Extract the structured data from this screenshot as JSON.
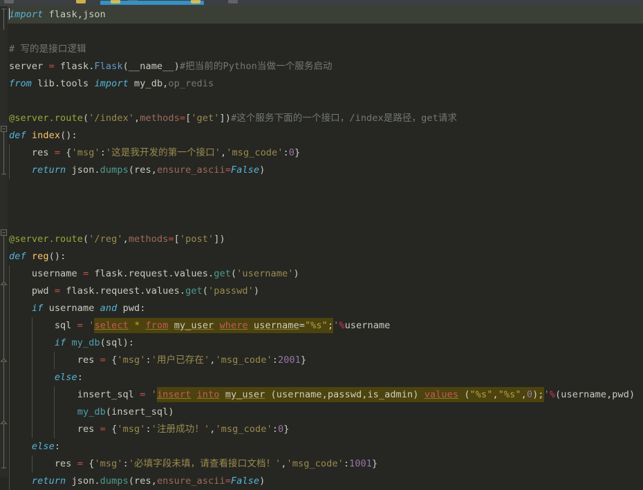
{
  "app": {
    "kind": "code-editor",
    "language": "Python",
    "theme": "darcula",
    "background": "#262722",
    "gutter_background": "#2B2C27",
    "current_line_background": "#3C3F36",
    "toolbar_background": "#3C3F41",
    "accent": "#3592C4"
  },
  "toolbar": {
    "progress_bar_color": "#3592C4",
    "icons": [
      {
        "name": "bulb-icon",
        "color": "#E8C44A"
      },
      {
        "name": "bulb-icon-2",
        "color": "#E8C44A"
      },
      {
        "name": "bulb-icon-3",
        "color": "#E8C44A"
      }
    ]
  },
  "colors": {
    "keyword": "#55B5DB",
    "string": "#9A8B4F",
    "number": "#9876AA",
    "comment": "#737874",
    "decorator": "#9AA83A",
    "function_def": "#FFC66D",
    "class_ref": "#6699CC",
    "operator": "#C7504B",
    "kwarg": "#9E6B5B",
    "sql_highlight_background": "#4C430E",
    "sql_keyword": "#C45B56"
  },
  "editor": {
    "caret_line": 1,
    "caret_column": 1,
    "lines": [
      {
        "n": 1,
        "current": true,
        "indent": 0,
        "caret": true,
        "tokens": [
          {
            "t": "import",
            "c": "kw"
          },
          {
            "t": " flask,json",
            "c": "txt"
          }
        ]
      },
      {
        "n": 2,
        "current": false,
        "indent": 0,
        "tokens": []
      },
      {
        "n": 3,
        "current": false,
        "indent": 0,
        "tokens": [
          {
            "t": "# 写的是接口逻辑",
            "c": "cmt"
          }
        ]
      },
      {
        "n": 4,
        "current": false,
        "indent": 0,
        "tokens": [
          {
            "t": "server ",
            "c": "txt"
          },
          {
            "t": "=",
            "c": "op"
          },
          {
            "t": " flask.",
            "c": "txt"
          },
          {
            "t": "Flask",
            "c": "cls"
          },
          {
            "t": "(",
            "c": "punc"
          },
          {
            "t": "__name__",
            "c": "txt"
          },
          {
            "t": ")",
            "c": "punc"
          },
          {
            "t": "#把当前的Python当做一个服务启动",
            "c": "cmt"
          }
        ]
      },
      {
        "n": 5,
        "current": false,
        "indent": 0,
        "tokens": [
          {
            "t": "from",
            "c": "kw"
          },
          {
            "t": " lib.tools ",
            "c": "txt"
          },
          {
            "t": "import",
            "c": "kw"
          },
          {
            "t": " my_db,",
            "c": "txt"
          },
          {
            "t": "op_redis",
            "c": "cmt"
          }
        ]
      },
      {
        "n": 6,
        "current": false,
        "indent": 0,
        "tokens": []
      },
      {
        "n": 7,
        "current": false,
        "indent": 0,
        "tokens": [
          {
            "t": "@server.route",
            "c": "dec"
          },
          {
            "t": "(",
            "c": "punc"
          },
          {
            "t": "'/index'",
            "c": "str"
          },
          {
            "t": ",",
            "c": "punc"
          },
          {
            "t": "methods",
            "c": "kwarg"
          },
          {
            "t": "=",
            "c": "op"
          },
          {
            "t": "[",
            "c": "punc"
          },
          {
            "t": "'get'",
            "c": "str"
          },
          {
            "t": "])",
            "c": "punc"
          },
          {
            "t": "#这个服务下面的一个接口，/index是路径，get请求",
            "c": "cmt"
          }
        ]
      },
      {
        "n": 8,
        "current": false,
        "indent": 0,
        "tokens": [
          {
            "t": "def",
            "c": "kw"
          },
          {
            "t": " ",
            "c": "txt"
          },
          {
            "t": "index",
            "c": "def"
          },
          {
            "t": "():",
            "c": "punc"
          }
        ]
      },
      {
        "n": 9,
        "current": false,
        "indent": 1,
        "tokens": [
          {
            "t": "res ",
            "c": "txt"
          },
          {
            "t": "=",
            "c": "op"
          },
          {
            "t": " {",
            "c": "punc"
          },
          {
            "t": "'msg'",
            "c": "str"
          },
          {
            "t": ":",
            "c": "punc"
          },
          {
            "t": "'这是我开发的第一个接口'",
            "c": "str"
          },
          {
            "t": ",",
            "c": "punc"
          },
          {
            "t": "'msg_code'",
            "c": "str"
          },
          {
            "t": ":",
            "c": "punc"
          },
          {
            "t": "0",
            "c": "num"
          },
          {
            "t": "}",
            "c": "punc"
          }
        ]
      },
      {
        "n": 10,
        "current": false,
        "indent": 1,
        "tokens": [
          {
            "t": "return",
            "c": "kw"
          },
          {
            "t": " json.",
            "c": "txt"
          },
          {
            "t": "dumps",
            "c": "fn"
          },
          {
            "t": "(res,",
            "c": "punc"
          },
          {
            "t": "ensure_ascii",
            "c": "kwarg"
          },
          {
            "t": "=",
            "c": "op"
          },
          {
            "t": "False",
            "c": "kw"
          },
          {
            "t": ")",
            "c": "punc"
          }
        ]
      },
      {
        "n": 11,
        "current": false,
        "indent": 0,
        "tokens": []
      },
      {
        "n": 12,
        "current": false,
        "indent": 0,
        "tokens": []
      },
      {
        "n": 13,
        "current": false,
        "indent": 0,
        "tokens": []
      },
      {
        "n": 14,
        "current": false,
        "indent": 0,
        "tokens": [
          {
            "t": "@server.route",
            "c": "dec"
          },
          {
            "t": "(",
            "c": "punc"
          },
          {
            "t": "'/reg'",
            "c": "str"
          },
          {
            "t": ",",
            "c": "punc"
          },
          {
            "t": "methods",
            "c": "kwarg"
          },
          {
            "t": "=",
            "c": "op"
          },
          {
            "t": "[",
            "c": "punc"
          },
          {
            "t": "'post'",
            "c": "str"
          },
          {
            "t": "])",
            "c": "punc"
          }
        ]
      },
      {
        "n": 15,
        "current": false,
        "indent": 0,
        "tokens": [
          {
            "t": "def",
            "c": "kw"
          },
          {
            "t": " ",
            "c": "txt"
          },
          {
            "t": "reg",
            "c": "def"
          },
          {
            "t": "():",
            "c": "punc"
          }
        ]
      },
      {
        "n": 16,
        "current": false,
        "indent": 1,
        "tokens": [
          {
            "t": "username ",
            "c": "txt"
          },
          {
            "t": "=",
            "c": "op"
          },
          {
            "t": " flask.request.values.",
            "c": "txt"
          },
          {
            "t": "get",
            "c": "fn"
          },
          {
            "t": "(",
            "c": "punc"
          },
          {
            "t": "'username'",
            "c": "str"
          },
          {
            "t": ")",
            "c": "punc"
          }
        ]
      },
      {
        "n": 17,
        "current": false,
        "indent": 1,
        "tokens": [
          {
            "t": "pwd ",
            "c": "txt"
          },
          {
            "t": "=",
            "c": "op"
          },
          {
            "t": " flask.request.values.",
            "c": "txt"
          },
          {
            "t": "get",
            "c": "fn"
          },
          {
            "t": "(",
            "c": "punc"
          },
          {
            "t": "'passwd'",
            "c": "str"
          },
          {
            "t": ")",
            "c": "punc"
          }
        ]
      },
      {
        "n": 18,
        "current": false,
        "indent": 1,
        "tokens": [
          {
            "t": "if",
            "c": "kw"
          },
          {
            "t": " username ",
            "c": "txt"
          },
          {
            "t": "and",
            "c": "kw"
          },
          {
            "t": " pwd",
            "c": "txt"
          },
          {
            "t": ":",
            "c": "punc"
          }
        ]
      },
      {
        "n": 19,
        "current": false,
        "indent": 2,
        "sql": "select",
        "tokens": []
      },
      {
        "n": 20,
        "current": false,
        "indent": 2,
        "tokens": [
          {
            "t": "if",
            "c": "kw"
          },
          {
            "t": " ",
            "c": "txt"
          },
          {
            "t": "my_db",
            "c": "mydb"
          },
          {
            "t": "(sql):",
            "c": "punc"
          }
        ]
      },
      {
        "n": 21,
        "current": false,
        "indent": 3,
        "tokens": [
          {
            "t": "res ",
            "c": "txt"
          },
          {
            "t": "=",
            "c": "op"
          },
          {
            "t": " {",
            "c": "punc"
          },
          {
            "t": "'msg'",
            "c": "str"
          },
          {
            "t": ":",
            "c": "punc"
          },
          {
            "t": "'用户已存在'",
            "c": "str"
          },
          {
            "t": ",",
            "c": "punc"
          },
          {
            "t": "'msg_code'",
            "c": "str"
          },
          {
            "t": ":",
            "c": "punc"
          },
          {
            "t": "2001",
            "c": "num"
          },
          {
            "t": "}",
            "c": "punc"
          }
        ]
      },
      {
        "n": 22,
        "current": false,
        "indent": 2,
        "tokens": [
          {
            "t": "else",
            "c": "kw"
          },
          {
            "t": ":",
            "c": "punc"
          }
        ]
      },
      {
        "n": 23,
        "current": false,
        "indent": 3,
        "sql": "insert",
        "tokens": []
      },
      {
        "n": 24,
        "current": false,
        "indent": 3,
        "tokens": [
          {
            "t": "my_db",
            "c": "mydb"
          },
          {
            "t": "(insert_sql)",
            "c": "punc"
          }
        ]
      },
      {
        "n": 25,
        "current": false,
        "indent": 3,
        "tokens": [
          {
            "t": "res ",
            "c": "txt"
          },
          {
            "t": "=",
            "c": "op"
          },
          {
            "t": " {",
            "c": "punc"
          },
          {
            "t": "'msg'",
            "c": "str"
          },
          {
            "t": ":",
            "c": "punc"
          },
          {
            "t": "'注册成功！'",
            "c": "str"
          },
          {
            "t": ",",
            "c": "punc"
          },
          {
            "t": "'msg_code'",
            "c": "str"
          },
          {
            "t": ":",
            "c": "punc"
          },
          {
            "t": "0",
            "c": "num"
          },
          {
            "t": "}",
            "c": "punc"
          }
        ]
      },
      {
        "n": 26,
        "current": false,
        "indent": 1,
        "tokens": [
          {
            "t": "else",
            "c": "kw"
          },
          {
            "t": ":",
            "c": "punc"
          }
        ]
      },
      {
        "n": 27,
        "current": false,
        "indent": 2,
        "tokens": [
          {
            "t": "res ",
            "c": "txt"
          },
          {
            "t": "=",
            "c": "op"
          },
          {
            "t": " {",
            "c": "punc"
          },
          {
            "t": "'msg'",
            "c": "str"
          },
          {
            "t": ":",
            "c": "punc"
          },
          {
            "t": "'必填字段未填，请查看接口文档！'",
            "c": "str"
          },
          {
            "t": ",",
            "c": "punc"
          },
          {
            "t": "'msg_code'",
            "c": "str"
          },
          {
            "t": ":",
            "c": "punc"
          },
          {
            "t": "1001",
            "c": "num"
          },
          {
            "t": "}",
            "c": "punc"
          }
        ]
      },
      {
        "n": 28,
        "current": false,
        "indent": 1,
        "tokens": [
          {
            "t": "return",
            "c": "kw"
          },
          {
            "t": " json.",
            "c": "txt"
          },
          {
            "t": "dumps",
            "c": "fn"
          },
          {
            "t": "(res,",
            "c": "punc"
          },
          {
            "t": "ensure_ascii",
            "c": "kwarg"
          },
          {
            "t": "=",
            "c": "op"
          },
          {
            "t": "False",
            "c": "kw"
          },
          {
            "t": ")",
            "c": "punc"
          }
        ]
      }
    ],
    "sql_lines": {
      "select": {
        "prefix": [
          {
            "t": "sql ",
            "c": "txt"
          },
          {
            "t": "=",
            "c": "op"
          },
          {
            "t": " ",
            "c": "txt"
          },
          {
            "t": "'",
            "c": "str"
          }
        ],
        "sql_tokens": [
          {
            "t": "select",
            "c": "sqlkw"
          },
          {
            "t": " ",
            "c": "sqlpn"
          },
          {
            "t": "*",
            "c": "sqlstar"
          },
          {
            "t": " ",
            "c": "sqlpn"
          },
          {
            "t": "from",
            "c": "sqlkw"
          },
          {
            "t": " ",
            "c": "sqlpn"
          },
          {
            "t": "my_user",
            "c": "sqlid"
          },
          {
            "t": " ",
            "c": "sqlpn"
          },
          {
            "t": "where",
            "c": "sqlkw"
          },
          {
            "t": " ",
            "c": "sqlpn"
          },
          {
            "t": "username",
            "c": "sqlid"
          },
          {
            "t": "=",
            "c": "sqlpn"
          },
          {
            "t": "\"%s\"",
            "c": "sqlstr"
          },
          {
            "t": ";",
            "c": "sqlpn"
          }
        ],
        "suffix": [
          {
            "t": "'",
            "c": "str"
          },
          {
            "t": "%",
            "c": "pct"
          },
          {
            "t": "username",
            "c": "txt"
          }
        ]
      },
      "insert": {
        "prefix": [
          {
            "t": "insert_sql ",
            "c": "txt"
          },
          {
            "t": "=",
            "c": "op"
          },
          {
            "t": " ",
            "c": "txt"
          },
          {
            "t": "'",
            "c": "str"
          }
        ],
        "sql_tokens": [
          {
            "t": "insert",
            "c": "sqlkw"
          },
          {
            "t": " ",
            "c": "sqlpn"
          },
          {
            "t": "into",
            "c": "sqlkw"
          },
          {
            "t": " ",
            "c": "sqlpn"
          },
          {
            "t": "my_user",
            "c": "sqlid"
          },
          {
            "t": " ",
            "c": "sqlpn"
          },
          {
            "t": "(username,passwd,is_admin)",
            "c": "sqlpn"
          },
          {
            "t": " ",
            "c": "sqlpn"
          },
          {
            "t": "values",
            "c": "sqlkw"
          },
          {
            "t": " ",
            "c": "sqlpn"
          },
          {
            "t": "(",
            "c": "sqlpn"
          },
          {
            "t": "\"%s\"",
            "c": "sqlstr"
          },
          {
            "t": ",",
            "c": "sqlpn"
          },
          {
            "t": "\"%s\"",
            "c": "sqlstr"
          },
          {
            "t": ",",
            "c": "sqlpn"
          },
          {
            "t": "0",
            "c": "sqlnum"
          },
          {
            "t": ");",
            "c": "sqlpn"
          }
        ],
        "suffix": [
          {
            "t": "'",
            "c": "str"
          },
          {
            "t": "%",
            "c": "pct"
          },
          {
            "t": "(username,pwd)",
            "c": "txt"
          }
        ]
      }
    }
  }
}
